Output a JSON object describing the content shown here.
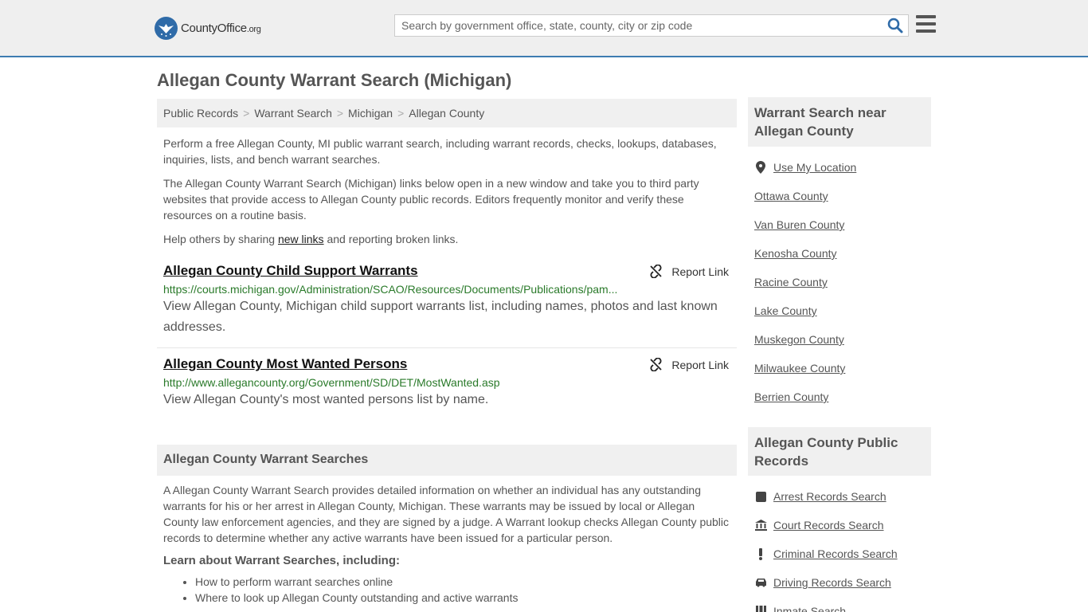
{
  "header": {
    "logo_text": "CountyOffice",
    "logo_ext": ".org",
    "search_placeholder": "Search by government office, state, county, city or zip code"
  },
  "page": {
    "title": "Allegan County Warrant Search (Michigan)"
  },
  "breadcrumb": [
    "Public Records",
    "Warrant Search",
    "Michigan",
    "Allegan County"
  ],
  "intro": {
    "p1": "Perform a free Allegan County, MI public warrant search, including warrant records, checks, lookups, databases, inquiries, lists, and bench warrant searches.",
    "p2": "The Allegan County Warrant Search (Michigan) links below open in a new window and take you to third party websites that provide access to Allegan County public records. Editors frequently monitor and verify these resources on a routine basis.",
    "p3_before": "Help others by sharing ",
    "p3_link": "new links",
    "p3_after": " and reporting broken links."
  },
  "links": [
    {
      "title": "Allegan County Child Support Warrants",
      "url": "https://courts.michigan.gov/Administration/SCAO/Resources/Documents/Publications/pam...",
      "desc": "View Allegan County, Michigan child support warrants list, including names, photos and last known addresses.",
      "report": "Report Link"
    },
    {
      "title": "Allegan County Most Wanted Persons",
      "url": "http://www.allegancounty.org/Government/SD/DET/MostWanted.asp",
      "desc": "View Allegan County's most wanted persons list by name.",
      "report": "Report Link"
    }
  ],
  "section": {
    "heading": "Allegan County Warrant Searches",
    "body": "A Allegan County Warrant Search provides detailed information on whether an individual has any outstanding warrants for his or her arrest in Allegan County, Michigan. These warrants may be issued by local or Allegan County law enforcement agencies, and they are signed by a judge. A Warrant lookup checks Allegan County public records to determine whether any active warrants have been issued for a particular person.",
    "learn": "Learn about Warrant Searches, including:",
    "bullets": [
      "How to perform warrant searches online",
      "Where to look up Allegan County outstanding and active warrants"
    ]
  },
  "sidebar": {
    "nearby_heading": "Warrant Search near Allegan County",
    "use_location": "Use My Location",
    "nearby": [
      "Ottawa County",
      "Van Buren County",
      "Kenosha County",
      "Racine County",
      "Lake County",
      "Muskegon County",
      "Milwaukee County",
      "Berrien County"
    ],
    "records_heading": "Allegan County Public Records",
    "records": [
      {
        "label": "Arrest Records Search",
        "icon": "square-icon"
      },
      {
        "label": "Court Records Search",
        "icon": "courthouse-icon"
      },
      {
        "label": "Criminal Records Search",
        "icon": "exclamation-icon"
      },
      {
        "label": "Driving Records Search",
        "icon": "car-icon"
      },
      {
        "label": "Inmate Search",
        "icon": "inmate-icon"
      }
    ]
  }
}
